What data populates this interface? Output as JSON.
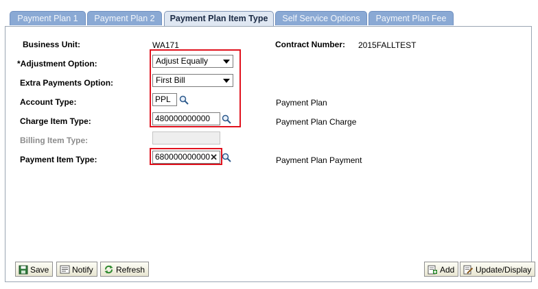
{
  "tabs": [
    {
      "label": "Payment Plan 1",
      "active": false
    },
    {
      "label": "Payment Plan 2",
      "active": false
    },
    {
      "label": "Payment Plan Item Type",
      "active": true
    },
    {
      "label": "Self Service Options",
      "active": false
    },
    {
      "label": "Payment Plan Fee",
      "active": false
    }
  ],
  "form": {
    "business_unit": {
      "label": "Business Unit:",
      "value": "WA171"
    },
    "contract_number": {
      "label": "Contract Number:",
      "value": "2015FALLTEST"
    },
    "adjustment_option": {
      "label": "*Adjustment Option:",
      "value": "Adjust Equally"
    },
    "extra_payments_option": {
      "label": "Extra Payments Option:",
      "value": "First Bill"
    },
    "account_type": {
      "label": "Account Type:",
      "value": "PPL",
      "description": "Payment Plan"
    },
    "charge_item_type": {
      "label": "Charge Item Type:",
      "value": "480000000000",
      "description": "Payment Plan Charge"
    },
    "billing_item_type": {
      "label": "Billing Item Type:",
      "value": ""
    },
    "payment_item_type": {
      "label": "Payment Item Type:",
      "value": "680000000000",
      "description": "Payment Plan Payment"
    }
  },
  "buttons": {
    "save": "Save",
    "notify": "Notify",
    "refresh": "Refresh",
    "add": "Add",
    "update_display": "Update/Display"
  },
  "colors": {
    "tab_inactive": "#8aa9d4",
    "tab_active": "#dfe7f2",
    "highlight": "#e0101c"
  }
}
